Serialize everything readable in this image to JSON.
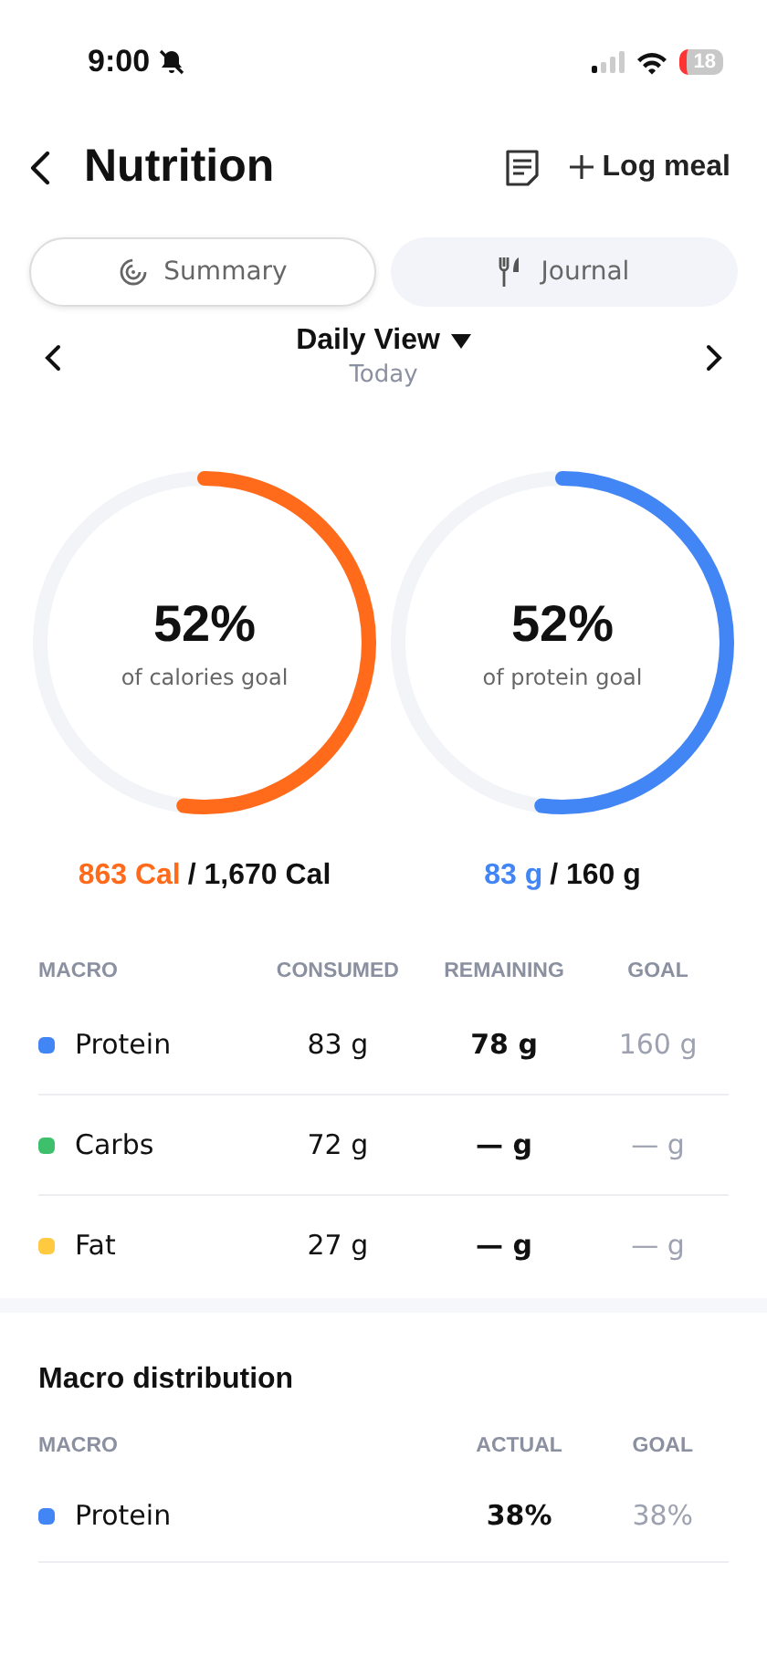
{
  "status_bar": {
    "time": "9:00",
    "battery": "18"
  },
  "header": {
    "title": "Nutrition",
    "action": "Log meal"
  },
  "tabs": [
    {
      "label": "Summary",
      "selected": true,
      "kind": "summary"
    },
    {
      "label": "Journal",
      "selected": false,
      "kind": "journal"
    }
  ],
  "period": {
    "title": "Daily View",
    "subtitle": "Today"
  },
  "rings": [
    {
      "percent": "52%",
      "caption": "of calories goal",
      "color": "#ff6b1a",
      "consumed": "863 Cal",
      "goal": "/ 1,670 Cal"
    },
    {
      "percent": "52%",
      "caption": "of protein goal",
      "color": "#4285f4",
      "consumed": "83 g",
      "goal": "/ 160 g"
    }
  ],
  "macros": {
    "columns": [
      "MACRO",
      "CONSUMED",
      "REMAINING",
      "GOAL"
    ],
    "rows": [
      {
        "name": "Protein",
        "color": "#4285f4",
        "consumed": "83 g",
        "remaining": "78 g",
        "goal": "160 g"
      },
      {
        "name": "Carbs",
        "color": "#3dbf6b",
        "consumed": "72 g",
        "remaining": "— g",
        "goal": "— g"
      },
      {
        "name": "Fat",
        "color": "#ffc940",
        "consumed": "27 g",
        "remaining": "— g",
        "goal": "— g"
      }
    ]
  },
  "distribution": {
    "title": "Macro distribution",
    "columns": [
      "MACRO",
      "ACTUAL",
      "GOAL"
    ],
    "rows": [
      {
        "name": "Protein",
        "color": "#4285f4",
        "actual": "38%",
        "goal": "38%"
      }
    ]
  }
}
